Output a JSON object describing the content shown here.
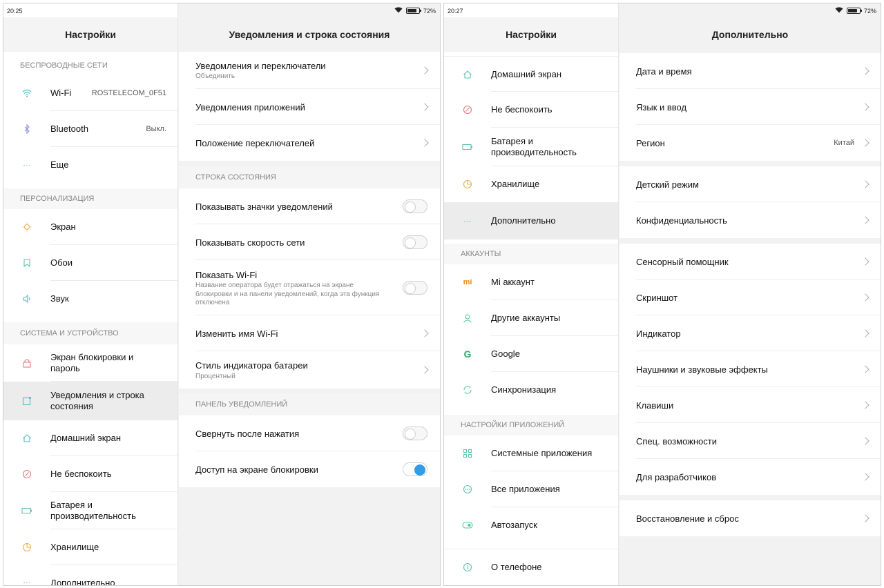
{
  "screen1": {
    "status": {
      "time": "20:25",
      "battery": "72%"
    },
    "left": {
      "title": "Настройки",
      "sections": {
        "wireless": "БЕСПРОВОДНЫЕ СЕТИ",
        "personal": "ПЕРСОНАЛИЗАЦИЯ",
        "system": "СИСТЕМА И УСТРОЙСТВО"
      },
      "items": {
        "wifi": {
          "label": "Wi-Fi",
          "value": "ROSTELECOM_0F51"
        },
        "bluetooth": {
          "label": "Bluetooth",
          "value": "Выкл."
        },
        "more": {
          "label": "Еще"
        },
        "display": {
          "label": "Экран"
        },
        "wallpaper": {
          "label": "Обои"
        },
        "sound": {
          "label": "Звук"
        },
        "lock": {
          "label": "Экран блокировки и пароль"
        },
        "notif": {
          "label": "Уведомления и строка состояния"
        },
        "home": {
          "label": "Домашний экран"
        },
        "dnd": {
          "label": "Не беспокоить"
        },
        "battery": {
          "label": "Батарея и производительность"
        },
        "storage": {
          "label": "Хранилище"
        },
        "additional": {
          "label": "Дополнительно"
        }
      }
    },
    "right": {
      "title": "Уведомления и строка состояния",
      "items": {
        "switches": {
          "label": "Уведомления и переключатели",
          "sub": "Объединить"
        },
        "app_notif": {
          "label": "Уведомления приложений"
        },
        "switch_pos": {
          "label": "Положение переключателей"
        },
        "sec_status": "СТРОКА СОСТОЯНИЯ",
        "show_icons": {
          "label": "Показывать значки уведомлений",
          "on": false
        },
        "net_speed": {
          "label": "Показывать скорость сети",
          "on": false
        },
        "show_wifi": {
          "label": "Показать Wi-Fi",
          "sub": "Название оператора будет отражаться на экране блокировки и на панели уведомлений, когда эта функция отключена",
          "on": false
        },
        "rename_wifi": {
          "label": "Изменить имя Wi-Fi"
        },
        "battery_style": {
          "label": "Стиль индикатора батареи",
          "sub": "Процентный"
        },
        "sec_panel": "ПАНЕЛЬ УВЕДОМЛЕНИЙ",
        "collapse": {
          "label": "Свернуть после нажатия",
          "on": false
        },
        "lock_access": {
          "label": "Доступ на экране блокировки",
          "on": true
        }
      }
    }
  },
  "screen2": {
    "status": {
      "time": "20:27",
      "battery": "72%"
    },
    "left": {
      "title": "Настройки",
      "sections": {
        "accounts": "АККАУНТЫ",
        "apps": "НАСТРОЙКИ ПРИЛОЖЕНИЙ"
      },
      "items": {
        "home": {
          "label": "Домашний экран"
        },
        "dnd": {
          "label": "Не беспокоить"
        },
        "battery": {
          "label": "Батарея и производительность"
        },
        "storage": {
          "label": "Хранилище"
        },
        "additional": {
          "label": "Дополнительно"
        },
        "mi": {
          "label": "Mi аккаунт"
        },
        "other_acc": {
          "label": "Другие аккаунты"
        },
        "google": {
          "label": "Google"
        },
        "sync": {
          "label": "Синхронизация"
        },
        "sys_apps": {
          "label": "Системные приложения"
        },
        "all_apps": {
          "label": "Все приложения"
        },
        "autostart": {
          "label": "Автозапуск"
        },
        "about": {
          "label": "О телефоне"
        }
      }
    },
    "right": {
      "title": "Дополнительно",
      "items": {
        "datetime": "Дата и время",
        "lang": "Язык и ввод",
        "region": {
          "label": "Регион",
          "value": "Китай"
        },
        "kids": "Детский режим",
        "privacy": "Конфиденциальность",
        "touch": "Сенсорный помощник",
        "screenshot": "Скриншот",
        "indicator": "Индикатор",
        "headphones": "Наушники и звуковые эффекты",
        "keys": "Клавиши",
        "access": "Спец. возможности",
        "dev": "Для разработчиков",
        "reset": "Восстановление и сброс"
      }
    }
  }
}
